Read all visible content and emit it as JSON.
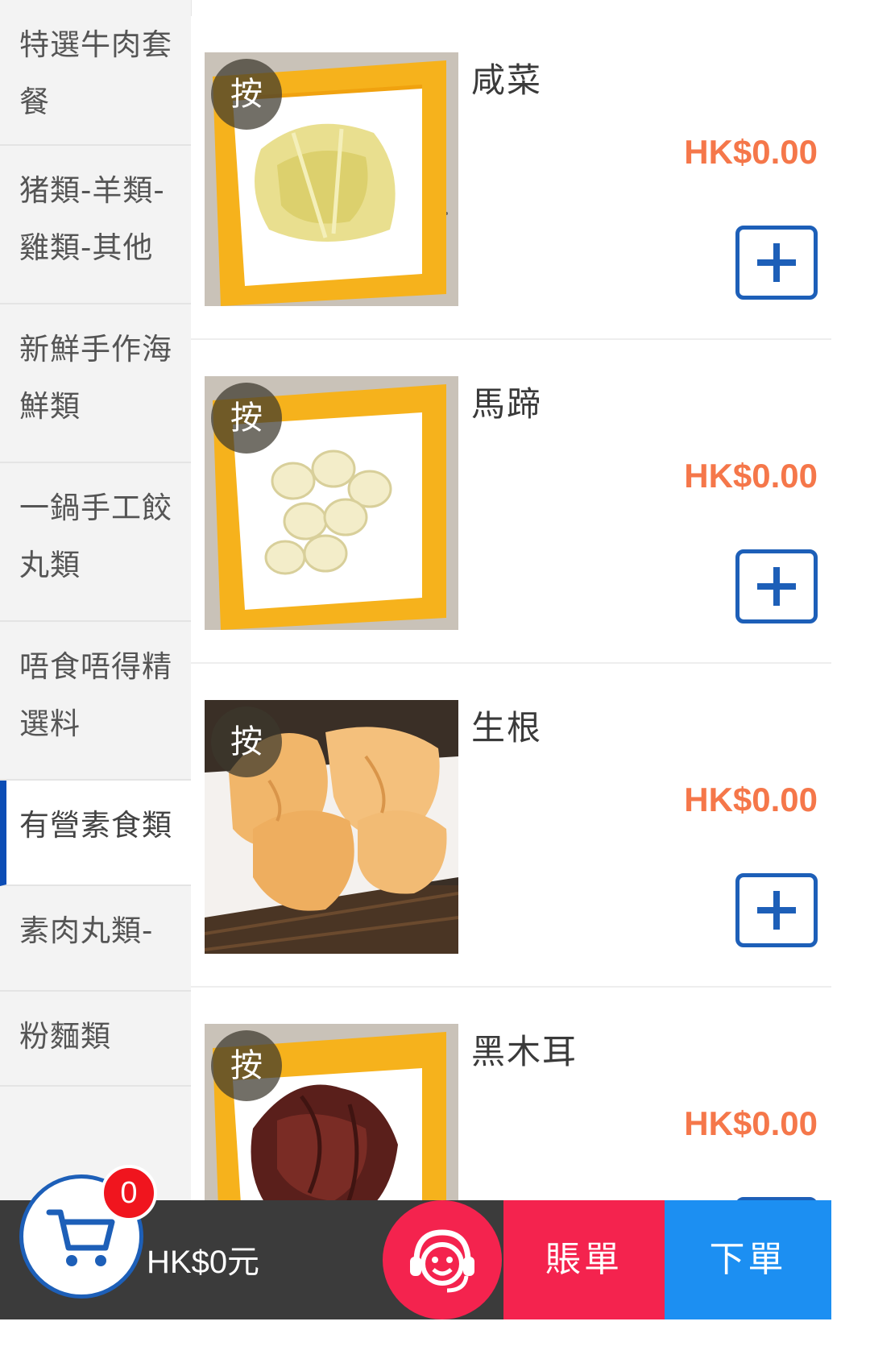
{
  "sidebar": {
    "categories": [
      {
        "label": "特選牛肉套餐",
        "active": false
      },
      {
        "label": "猪類-羊類-雞類-其他",
        "active": false
      },
      {
        "label": "新鮮手作海鮮類",
        "active": false
      },
      {
        "label": "一鍋手工餃丸類",
        "active": false
      },
      {
        "label": "唔食唔得精選料",
        "active": false
      },
      {
        "label": "有營素食類",
        "active": true
      },
      {
        "label": "素肉丸類-",
        "active": false
      },
      {
        "label": "粉麵類",
        "active": false
      }
    ]
  },
  "items": [
    {
      "name": "咸菜",
      "price": "HK$0.00",
      "badge": "按",
      "image": "pickled-cabbage-photo"
    },
    {
      "name": "馬蹄",
      "price": "HK$0.00",
      "badge": "按",
      "image": "water-chestnut-photo"
    },
    {
      "name": "生根",
      "price": "HK$0.00",
      "badge": "按",
      "image": "fried-gluten-photo"
    },
    {
      "name": "黑木耳",
      "price": "HK$0.00",
      "badge": "按",
      "image": "black-fungus-photo"
    }
  ],
  "bottom_bar": {
    "cart_count": "0",
    "total": "HK$0元",
    "bill_label": "賬單",
    "order_label": "下單"
  },
  "icons": {
    "cart": "cart-icon",
    "service": "customer-service-icon",
    "add": "plus-icon"
  },
  "colors": {
    "accent_blue": "#1d5fb8",
    "price_orange": "#f5774a",
    "bill_red": "#f4234e",
    "order_blue": "#1c8ff2"
  }
}
